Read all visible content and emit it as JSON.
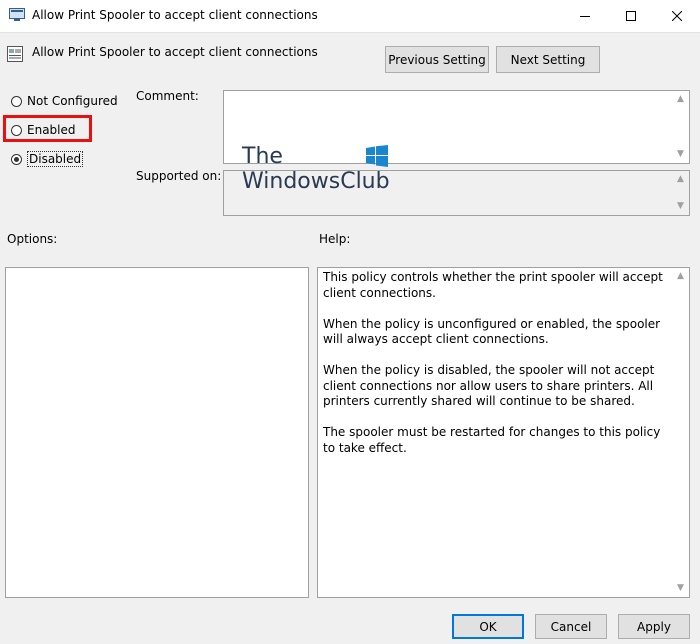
{
  "window": {
    "title": "Allow Print Spooler to accept client connections"
  },
  "header": {
    "policy_title": "Allow Print Spooler to accept client connections",
    "prev_label": "Previous Setting",
    "next_label": "Next Setting"
  },
  "state": {
    "options": [
      {
        "label": "Not Configured",
        "checked": false
      },
      {
        "label": "Enabled",
        "checked": false
      },
      {
        "label": "Disabled",
        "checked": true
      }
    ],
    "highlight_color": "#e81010"
  },
  "fields": {
    "comment_label": "Comment:",
    "comment_value": "",
    "supported_label": "Supported on:",
    "supported_value": ""
  },
  "watermark": {
    "line1": "The",
    "line2": "WindowsClub",
    "logo_color": "#1a86d0"
  },
  "panels": {
    "options_label": "Options:",
    "help_label": "Help:",
    "help_paragraphs": [
      "This policy controls whether the print spooler will accept client connections.",
      "When the policy is unconfigured or enabled, the spooler will always accept client connections.",
      "When the policy is disabled, the spooler will not accept client connections nor allow users to share printers.  All printers currently shared will continue to be shared.",
      "The spooler must be restarted for changes to this policy to take effect."
    ]
  },
  "footer": {
    "ok_label": "OK",
    "cancel_label": "Cancel",
    "apply_label": "Apply"
  },
  "icons": {
    "app": "policy-editor-icon",
    "policy": "policy-setting-icon",
    "minimize": "minimize-icon",
    "maximize": "maximize-icon",
    "close": "close-icon"
  }
}
